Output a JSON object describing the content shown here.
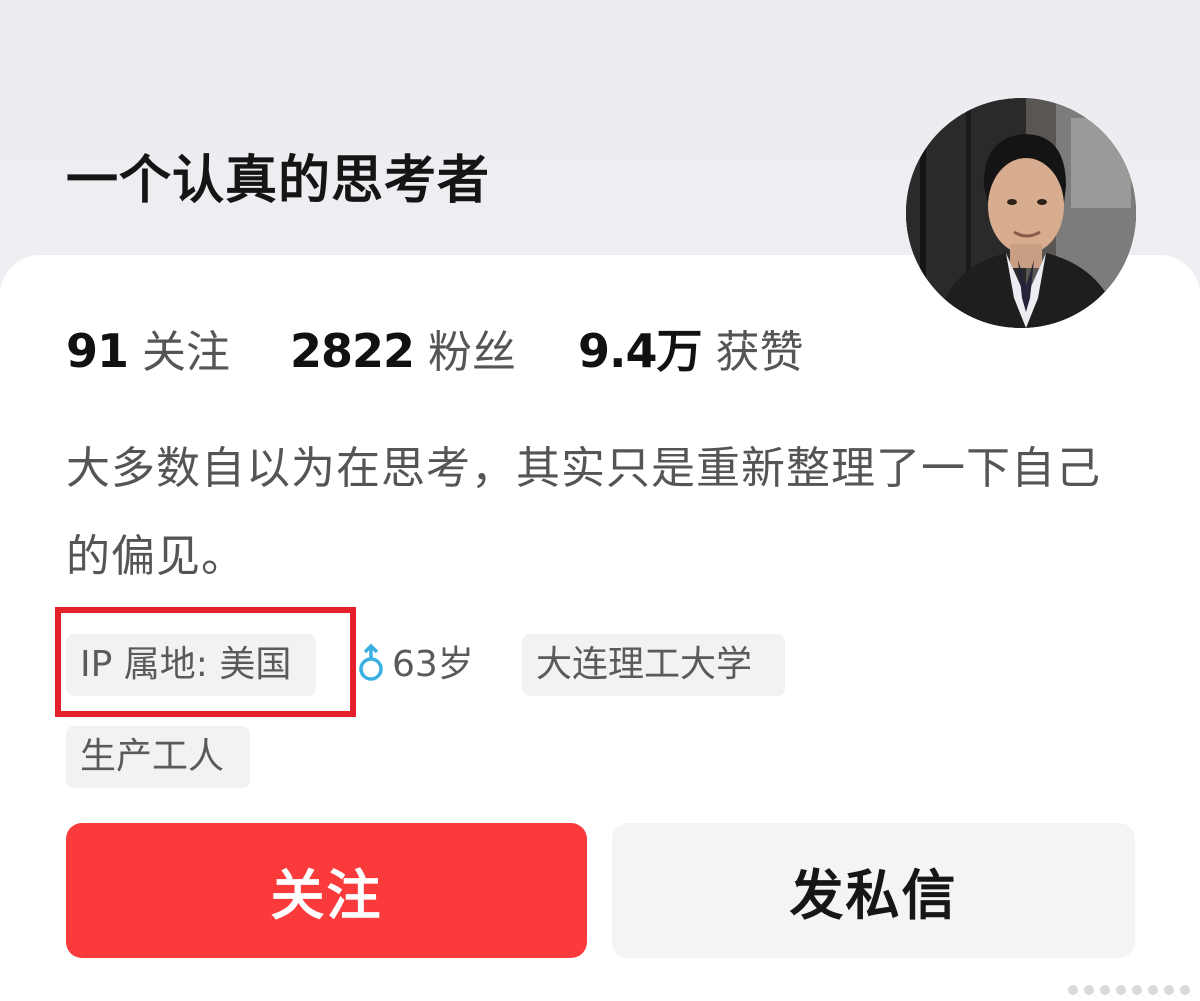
{
  "profile": {
    "username": "一个认真的思考者",
    "avatar_icon": "user-photo-avatar"
  },
  "stats": {
    "following_count": "91",
    "following_label": "关注",
    "fans_count": "2822",
    "fans_label": "粉丝",
    "likes_count": "9.4万",
    "likes_label": "获赞"
  },
  "bio": "大多数自以为在思考，其实只是重新整理了一下自己的偏见。",
  "tags": {
    "ip_location": "IP 属地: 美国",
    "age": "63岁",
    "gender_icon": "male-icon",
    "school": "大连理工大学",
    "occupation": "生产工人"
  },
  "actions": {
    "follow_label": "关注",
    "message_label": "发私信"
  },
  "colors": {
    "follow_button": "#fb3b3b",
    "highlight_box": "#e4202a",
    "male_icon": "#3ab0e2"
  }
}
